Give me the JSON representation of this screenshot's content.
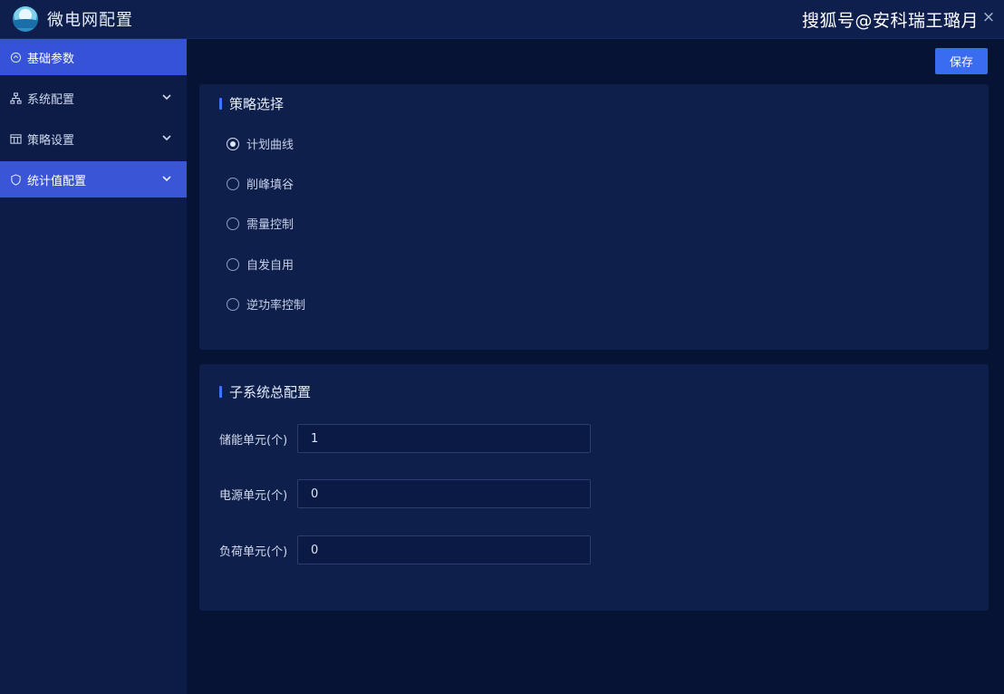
{
  "window": {
    "title": "微电网配置",
    "watermark": "搜狐号@安科瑞王璐月",
    "close_glyph": "×"
  },
  "sidebar": {
    "items": [
      {
        "label": "基础参数",
        "icon": "home-icon",
        "active": true
      },
      {
        "label": "系统配置",
        "icon": "network-icon",
        "expandable": true
      },
      {
        "label": "策略设置",
        "icon": "table-icon",
        "expandable": true
      },
      {
        "label": "统计值配置",
        "icon": "shield-icon",
        "expandable": true,
        "highlighted": true
      }
    ]
  },
  "toolbar": {
    "save_label": "保存"
  },
  "strategy": {
    "title": "策略选择",
    "options": [
      {
        "label": "计划曲线",
        "checked": true
      },
      {
        "label": "削峰填谷",
        "checked": false
      },
      {
        "label": "需量控制",
        "checked": false
      },
      {
        "label": "自发自用",
        "checked": false
      },
      {
        "label": "逆功率控制",
        "checked": false
      }
    ]
  },
  "subsystem": {
    "title": "子系统总配置",
    "fields": [
      {
        "label": "储能单元(个)",
        "value": "1"
      },
      {
        "label": "电源单元(个)",
        "value": "0"
      },
      {
        "label": "负荷单元(个)",
        "value": "0"
      }
    ]
  },
  "colors": {
    "accent": "#3a6cf2",
    "sidebar_active": "#3652d8",
    "background": "#071334",
    "card": "#0e1f4b"
  }
}
